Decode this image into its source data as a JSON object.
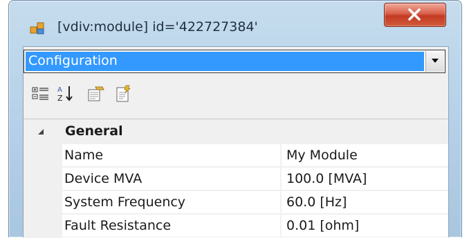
{
  "window": {
    "title": "[vdiv:module] id='422727384'",
    "icon": "app-window-icon",
    "close_icon": "close-icon"
  },
  "combo": {
    "selected": "Configuration",
    "arrow_icon": "chevron-down-icon"
  },
  "toolbar": {
    "buttons": [
      {
        "icon": "categorized-icon"
      },
      {
        "icon": "alphabetical-sort-icon"
      },
      {
        "icon": "property-pages-icon"
      },
      {
        "icon": "events-icon"
      }
    ]
  },
  "grid": {
    "category": {
      "label": "General",
      "expanded": true
    },
    "properties": [
      {
        "name": "Name",
        "value": "My Module"
      },
      {
        "name": "Device MVA",
        "value": "100.0 [MVA]"
      },
      {
        "name": "System Frequency",
        "value": "60.0 [Hz]"
      },
      {
        "name": "Fault Resistance",
        "value": "0.01 [ohm]"
      }
    ]
  },
  "colors": {
    "selection": "#3399ff",
    "close_button": "#c23a22",
    "frame": "#b8d3ea"
  }
}
